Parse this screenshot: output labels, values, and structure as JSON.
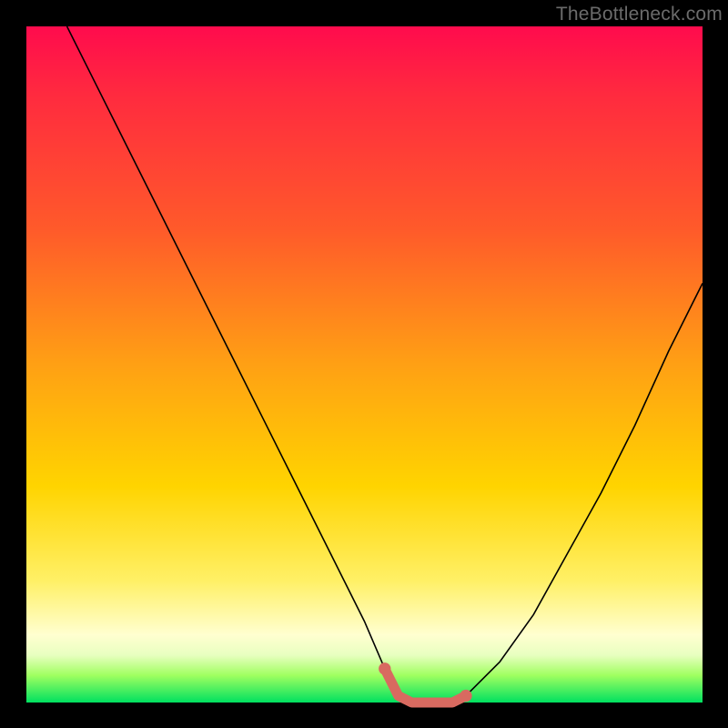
{
  "attribution": "TheBottleneck.com",
  "colors": {
    "frame": "#000000",
    "gradient_stops": [
      "#ff0b4d",
      "#ff2a3f",
      "#ff5a2a",
      "#ffa014",
      "#ffd400",
      "#fff066",
      "#ffffd0",
      "#e8ffc0",
      "#9fff60",
      "#00e060"
    ],
    "curve_stroke": "#000000",
    "thick_stroke": "#d86a60"
  },
  "chart_data": {
    "type": "line",
    "title": "",
    "xlabel": "",
    "ylabel": "",
    "xlim": [
      0,
      100
    ],
    "ylim": [
      0,
      100
    ],
    "series": [
      {
        "name": "bottleneck-curve",
        "x": [
          6,
          10,
          15,
          20,
          25,
          30,
          35,
          40,
          45,
          50,
          53,
          55,
          57,
          60,
          63,
          65,
          70,
          75,
          80,
          85,
          90,
          95,
          100
        ],
        "values": [
          100,
          92,
          82,
          72,
          62,
          52,
          42,
          32,
          22,
          12,
          5,
          1,
          0,
          0,
          0,
          1,
          6,
          13,
          22,
          31,
          41,
          52,
          62
        ]
      },
      {
        "name": "flat-minimum-highlight",
        "x": [
          53,
          55,
          57,
          60,
          63,
          65
        ],
        "values": [
          5,
          1,
          0,
          0,
          0,
          1
        ]
      }
    ],
    "annotations": []
  }
}
